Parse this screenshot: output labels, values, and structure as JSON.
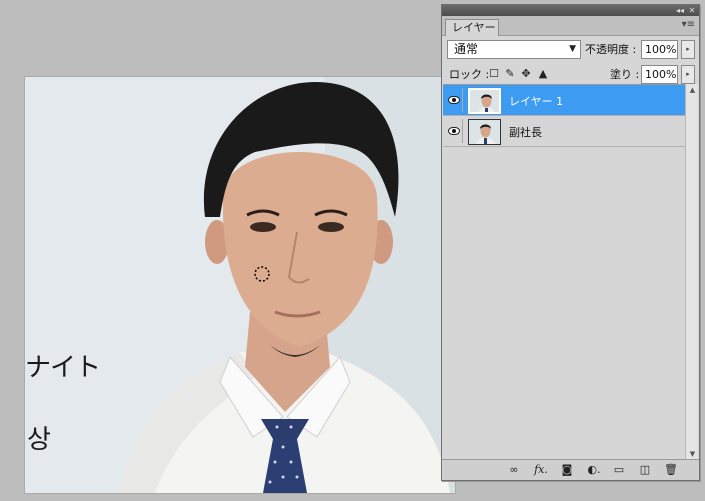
{
  "document": {
    "board_text_1": "ナイト",
    "board_text_2": "상"
  },
  "layers_panel": {
    "tab_label": "レイヤー",
    "collapse_glyph": "◂◂",
    "close_glyph": "✕",
    "menu_glyph": "▾≡",
    "blend_mode": "通常",
    "opacity_label": "不透明度 :",
    "opacity_value": "100%",
    "lock_label": "ロック :",
    "fill_label": "塗り :",
    "fill_value": "100%",
    "flyout_glyph": "▸",
    "layers": [
      {
        "name": "レイヤー 1",
        "selected": true
      },
      {
        "name": "副社長",
        "selected": false
      }
    ],
    "footer_icons": [
      "link-icon",
      "fx-icon",
      "mask-icon",
      "adjustment-icon",
      "group-icon",
      "new-layer-icon",
      "trash-icon"
    ]
  },
  "colors": {
    "selection_blue": "#3d9bf2",
    "panel_gray": "#d6d6d6",
    "background_gray": "#bdbdbd"
  }
}
